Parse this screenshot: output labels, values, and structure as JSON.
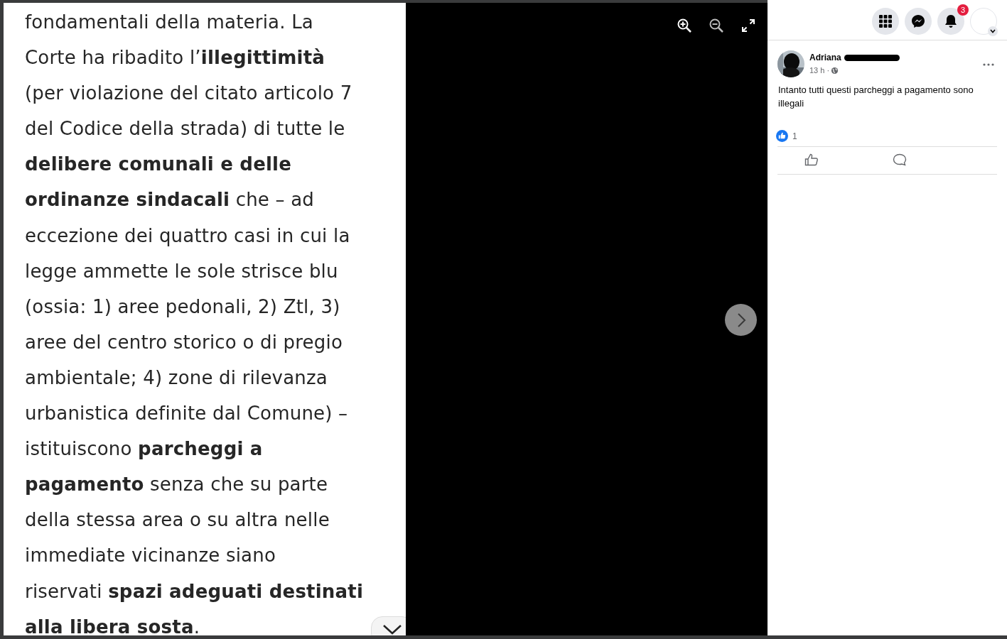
{
  "article": {
    "text": "fondamentali della materia. La\nCorte ha ribadito l’**illegittimità**\n(per violazione del citato articolo 7\ndel Codice della strada) di tutte le\n**delibere comunali e delle**\n**ordinanze sindacali** che – ad\neccezione dei quattro casi in cui la\nlegge ammette le sole strisce blu\n(ossia: 1) aree pedonali, 2) Ztl, 3)\naree del centro storico o di pregio\nambientale; 4) zone di rilevanza\nurbanistica definite dal Comune) –\nistituiscono **parcheggi a**\n**pagamento** senza che su parte\ndella stessa area o su altra nelle\nimmediate vicinanze siano\nriservati **spazi adeguati destinati**\n**alla libera sosta**."
  },
  "viewer_controls": [
    {
      "kind": "zoom-in"
    },
    {
      "kind": "zoom-out"
    },
    {
      "kind": "fullscreen"
    }
  ],
  "top_bar": {
    "notification_count": "3"
  },
  "comment": {
    "author": "Adriana",
    "time": "13 h ·",
    "text": "Intanto tutti questi parcheggi a pagamento sono illegali",
    "reaction_count": "1"
  }
}
